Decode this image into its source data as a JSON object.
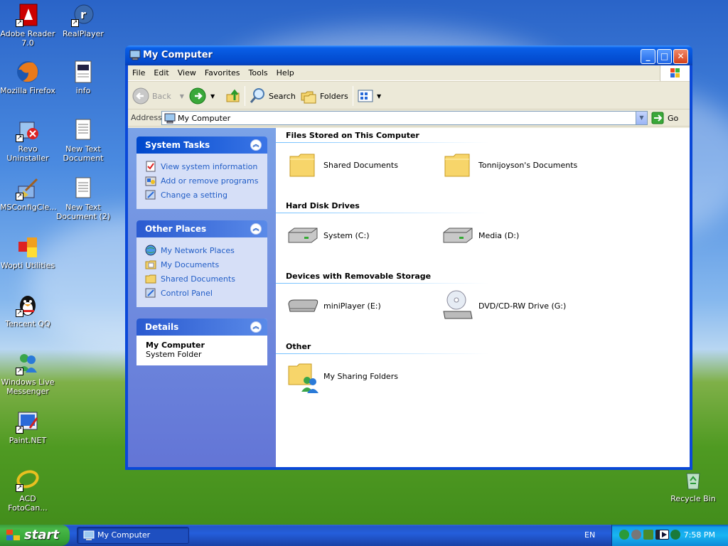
{
  "desktop": {
    "icons": [
      {
        "label": "Adobe Reader 7.0"
      },
      {
        "label": "RealPlayer"
      },
      {
        "label": "Mozilla Firefox"
      },
      {
        "label": "info"
      },
      {
        "label": "Revo Uninstaller"
      },
      {
        "label": "New Text Document"
      },
      {
        "label": "MSConfigCle..."
      },
      {
        "label": "New Text Document (2)"
      },
      {
        "label": "Wopti Utilities"
      },
      {
        "label": "Tencent QQ"
      },
      {
        "label": "Windows Live Messenger"
      },
      {
        "label": "Paint.NET"
      },
      {
        "label": "ACD FotoCan..."
      },
      {
        "label": "Recycle Bin"
      }
    ]
  },
  "window": {
    "title": "My Computer",
    "menu": [
      "File",
      "Edit",
      "View",
      "Favorites",
      "Tools",
      "Help"
    ],
    "toolbar": {
      "back": "Back",
      "search": "Search",
      "folders": "Folders"
    },
    "address": {
      "label": "Address",
      "value": "My Computer",
      "go": "Go"
    },
    "left_pane": {
      "system_tasks": {
        "title": "System Tasks",
        "items": [
          "View system information",
          "Add or remove programs",
          "Change a setting"
        ]
      },
      "other_places": {
        "title": "Other Places",
        "items": [
          "My Network Places",
          "My Documents",
          "Shared Documents",
          "Control Panel"
        ]
      },
      "details": {
        "title": "Details",
        "name": "My Computer",
        "type": "System Folder"
      }
    },
    "groups": {
      "files": {
        "title": "Files Stored on This Computer",
        "items": [
          "Shared Documents",
          "Tonnijoyson's Documents"
        ]
      },
      "drives": {
        "title": "Hard Disk Drives",
        "items": [
          "System (C:)",
          "Media (D:)"
        ]
      },
      "removable": {
        "title": "Devices with Removable Storage",
        "items": [
          "miniPlayer (E:)",
          "DVD/CD-RW Drive (G:)"
        ]
      },
      "other": {
        "title": "Other",
        "items": [
          "My Sharing Folders"
        ]
      }
    }
  },
  "taskbar": {
    "start": "start",
    "task": "My Computer",
    "lang": "EN",
    "clock": "7:58 PM"
  }
}
